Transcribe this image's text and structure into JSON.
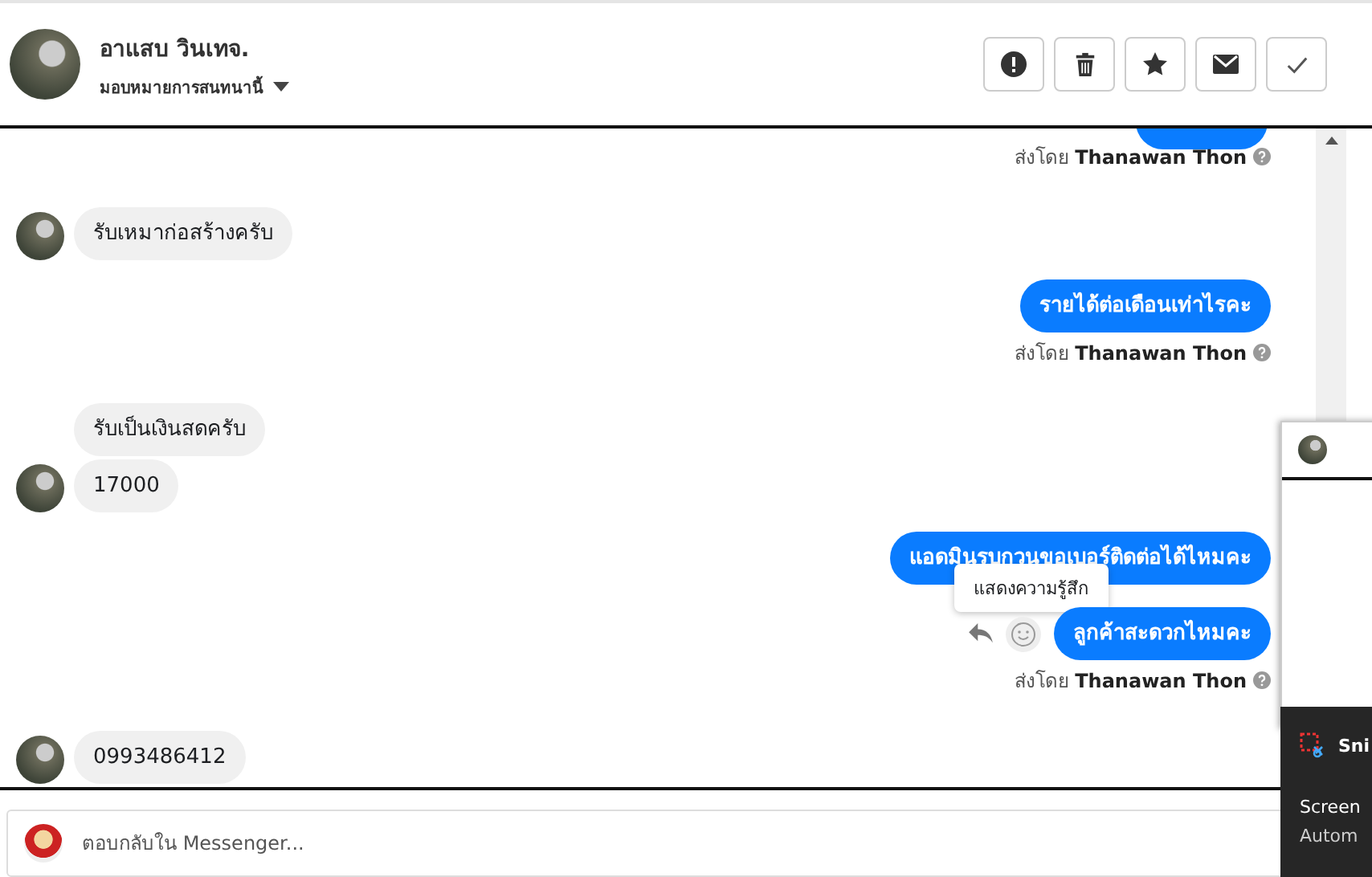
{
  "header": {
    "name": "อาแสบ วินเทจ.",
    "assign": "มอบหมายการสนทนานี้",
    "actions": [
      {
        "kind": "alert"
      },
      {
        "kind": "trash"
      },
      {
        "kind": "star"
      },
      {
        "kind": "mail"
      },
      {
        "kind": "check"
      }
    ]
  },
  "messages": [
    {
      "kind": "out_cut",
      "sender_prefix": "ส่งโดย",
      "sender": "Thanawan Thon"
    },
    {
      "kind": "in",
      "texts": [
        "รับเหมาก่อสร้างครับ"
      ]
    },
    {
      "kind": "out",
      "texts": [
        "รายได้ต่อเดือนเท่าไรคะ"
      ],
      "sender_prefix": "ส่งโดย",
      "sender": "Thanawan Thon"
    },
    {
      "kind": "in",
      "texts": [
        "รับเป็นเงินสดครับ",
        "17000"
      ]
    },
    {
      "kind": "out",
      "texts": [
        "แอดมินรบกวนขอเบอร์ติดต่อได้ไหมคะ",
        "ลูกค้าสะดวกไหมคะ"
      ],
      "tooltip": "แสดงความรู้สึก",
      "sender_prefix": "ส่งโดย",
      "sender": "Thanawan Thon"
    },
    {
      "kind": "in",
      "texts": [
        "0993486412"
      ]
    }
  ],
  "composer": {
    "placeholder": "ตอบกลับใน Messenger..."
  },
  "notification": {
    "app": "Sni",
    "title": "Screen",
    "subtitle": "Autom"
  }
}
